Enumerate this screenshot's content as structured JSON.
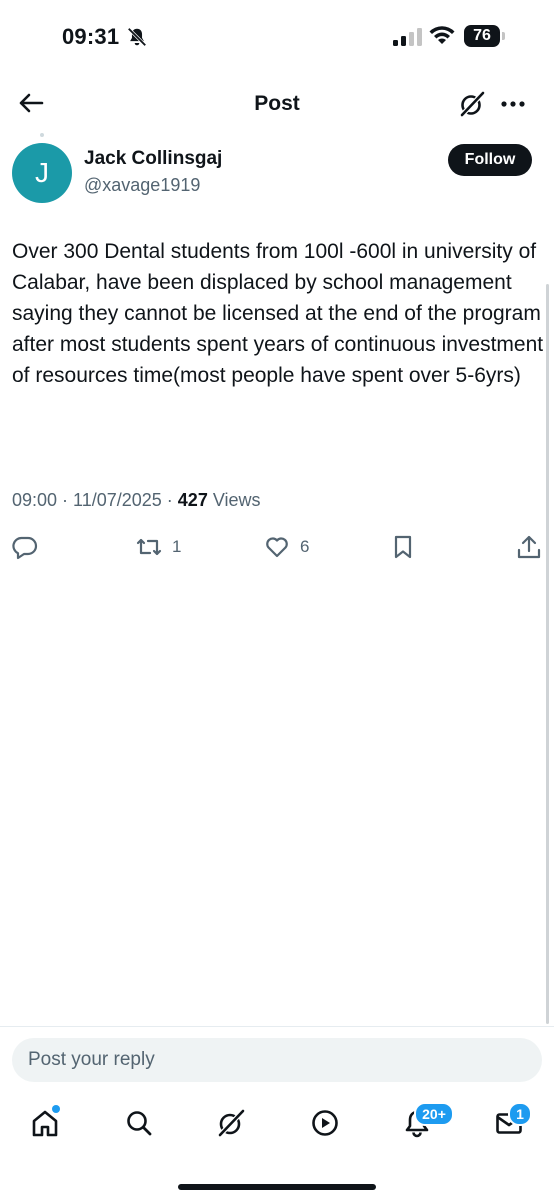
{
  "status_bar": {
    "time": "09:31",
    "battery": "76"
  },
  "header": {
    "title": "Post"
  },
  "post": {
    "avatar_letter": "J",
    "author_name": "Jack Collinsgaj",
    "author_handle": "@xavage1919",
    "follow_label": "Follow",
    "text": "Over 300 Dental students from 100l -600l in university of Calabar, have been displaced by school management saying they cannot be licensed at the end of the program after most students spent years of continuous investment of resources time(most people have spent over 5-6yrs)",
    "timestamp": "09:00 · 11/07/2025 · ",
    "views_count": "427",
    "views_label": "Views",
    "reposts": "1",
    "likes": "6"
  },
  "reply": {
    "placeholder": "Post your reply"
  },
  "tabbar": {
    "notifications_badge": "20+",
    "messages_badge": "1"
  },
  "colors": {
    "avatar": "#1b9aa8",
    "accent": "#1d9bf0",
    "secondary_text": "#536471",
    "primary_text": "#0f1419"
  },
  "icons": [
    "back-arrow-icon",
    "grok-icon",
    "more-icon",
    "reply-icon",
    "repost-icon",
    "like-icon",
    "bookmark-icon",
    "share-icon",
    "home-icon",
    "search-icon",
    "grok-tab-icon",
    "video-icon",
    "bell-icon",
    "mail-icon",
    "bell-off-icon",
    "signal-icon",
    "wifi-icon",
    "battery-icon"
  ]
}
